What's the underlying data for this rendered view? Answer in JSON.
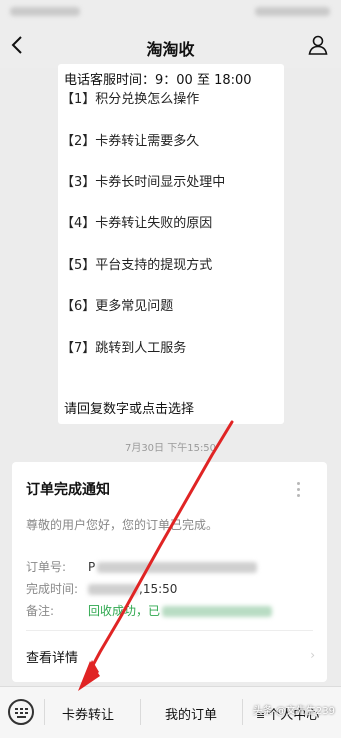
{
  "nav": {
    "title": "淘淘收"
  },
  "menu": {
    "hours": "电话客服时间：9：00 至 18:00",
    "options": [
      "【1】积分兑换怎么操作",
      "【2】卡券转让需要多久",
      "【3】卡券长时间显示处理中",
      "【4】卡券转让失败的原因",
      "【5】平台支持的提现方式",
      "【6】更多常见问题",
      "【7】跳转到人工服务"
    ],
    "prompt": "请回复数字或点击选择"
  },
  "timestamp": "7月30日 下午15:50",
  "notice": {
    "title": "订单完成通知",
    "greeting": "尊敬的用户您好，您的订单已完成。",
    "order_label": "订单号:",
    "order_value": "P",
    "time_label": "完成时间:",
    "time_value": ",15:50",
    "note_label": "备注:",
    "note_value": "回收成功，已",
    "detail": "查看详情"
  },
  "bottom_bar": {
    "tab1": "卡券转让",
    "tab2": "我的订单",
    "tab3": "个人中心"
  },
  "watermark": "头条 @文先生239",
  "colors": {
    "arrow": "#e02424",
    "success": "#2fa84f"
  }
}
